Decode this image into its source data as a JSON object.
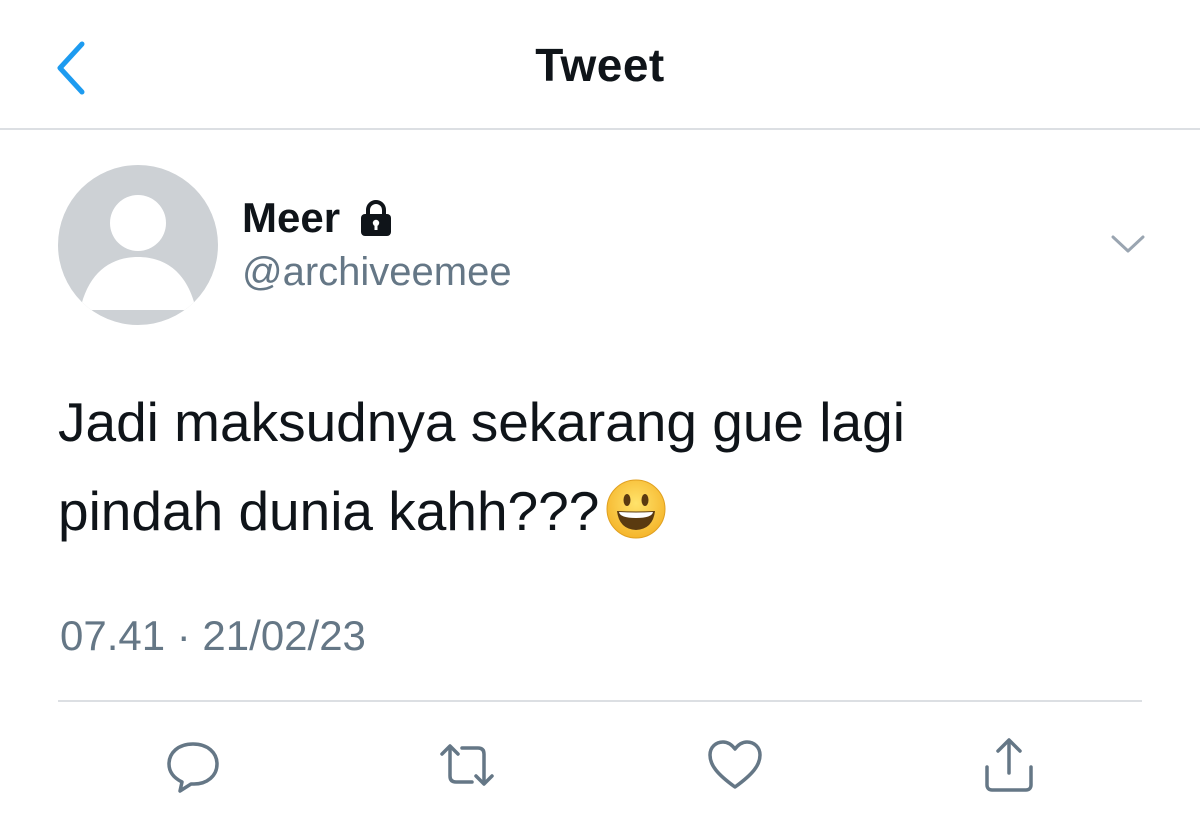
{
  "header": {
    "title": "Tweet",
    "back_icon": "chevron-left-icon"
  },
  "colors": {
    "accent": "#1d9bf0",
    "text_primary": "#0f1419",
    "text_secondary": "#657786",
    "divider": "#dcdfe3",
    "avatar_bg": "#cdd1d5"
  },
  "tweet": {
    "author": {
      "display_name": "Meer",
      "username": "@archiveemee",
      "protected_icon": "lock-icon",
      "avatar_icon": "default-avatar-icon"
    },
    "text": "Jadi maksudnya sekarang gue lagi\npindah dunia kahh???",
    "emoji": "smiling-face-emoji",
    "timestamp": "07.41 · 21/02/23",
    "more_icon": "chevron-down-icon"
  },
  "actions": [
    {
      "name": "reply",
      "icon": "reply-icon"
    },
    {
      "name": "retweet",
      "icon": "retweet-icon"
    },
    {
      "name": "like",
      "icon": "heart-icon"
    },
    {
      "name": "share",
      "icon": "share-icon"
    }
  ]
}
